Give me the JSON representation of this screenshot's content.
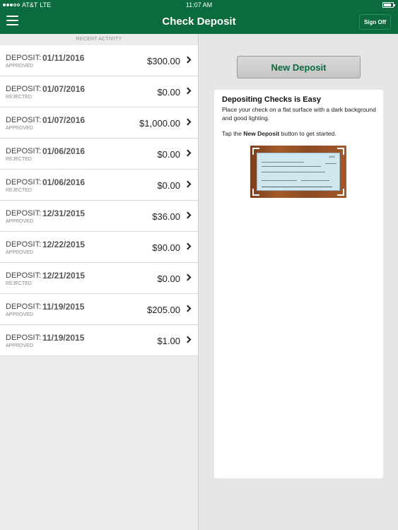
{
  "status": {
    "carrier": "AT&T",
    "network": "LTE",
    "time": "11:07 AM",
    "battery": 0.85
  },
  "header": {
    "title": "Check Deposit",
    "signoff": "Sign Off",
    "menu_icon": "hamburger-icon"
  },
  "recent": {
    "label": "RECENT ACTIVITY"
  },
  "deposits": [
    {
      "type": "DEPOSIT:",
      "date": "01/11/2016",
      "status": "APPROVED",
      "amount": "$300.00"
    },
    {
      "type": "DEPOSIT:",
      "date": "01/07/2016",
      "status": "REJECTED",
      "amount": "$0.00"
    },
    {
      "type": "DEPOSIT:",
      "date": "01/07/2016",
      "status": "APPROVED",
      "amount": "$1,000.00"
    },
    {
      "type": "DEPOSIT:",
      "date": "01/06/2016",
      "status": "REJECTED",
      "amount": "$0.00"
    },
    {
      "type": "DEPOSIT:",
      "date": "01/06/2016",
      "status": "REJECTED",
      "amount": "$0.00"
    },
    {
      "type": "DEPOSIT:",
      "date": "12/31/2015",
      "status": "APPROVED",
      "amount": "$36.00"
    },
    {
      "type": "DEPOSIT:",
      "date": "12/22/2015",
      "status": "APPROVED",
      "amount": "$90.00"
    },
    {
      "type": "DEPOSIT:",
      "date": "12/21/2015",
      "status": "REJECTED",
      "amount": "$0.00"
    },
    {
      "type": "DEPOSIT:",
      "date": "11/19/2015",
      "status": "APPROVED",
      "amount": "$205.00"
    },
    {
      "type": "DEPOSIT:",
      "date": "11/19/2015",
      "status": "APPROVED",
      "amount": "$1.00"
    }
  ],
  "actions": {
    "new_deposit": "New Deposit"
  },
  "info": {
    "title": "Depositing Checks is Easy",
    "text": "Place your check on a flat surface with a dark background and good lighting.",
    "tap_prefix": "Tap the ",
    "tap_button": "New Deposit",
    "tap_suffix": " button to get started.",
    "check_number": "1001"
  }
}
